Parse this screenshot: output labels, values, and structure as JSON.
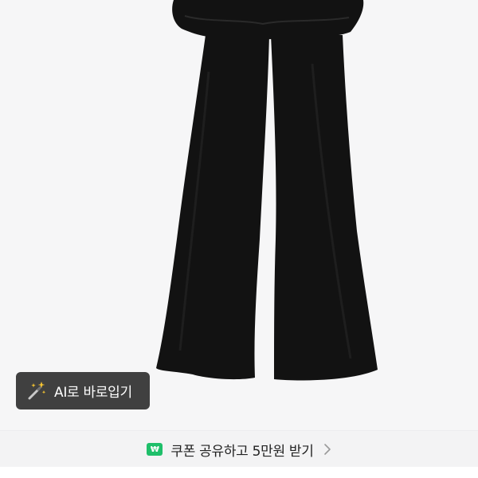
{
  "product": {
    "image_alt": "Black flared pants with ruffle peplum waist"
  },
  "ai_button": {
    "icon": "magic-wand-icon",
    "label": "AI로 바로입기"
  },
  "coupon_bar": {
    "badge_icon": "won-badge-icon",
    "badge_symbol": "₩",
    "text": "쿠폰 공유하고 5만원 받기",
    "chevron_icon": "chevron-right-icon",
    "badge_color": "#1fbf6a"
  }
}
